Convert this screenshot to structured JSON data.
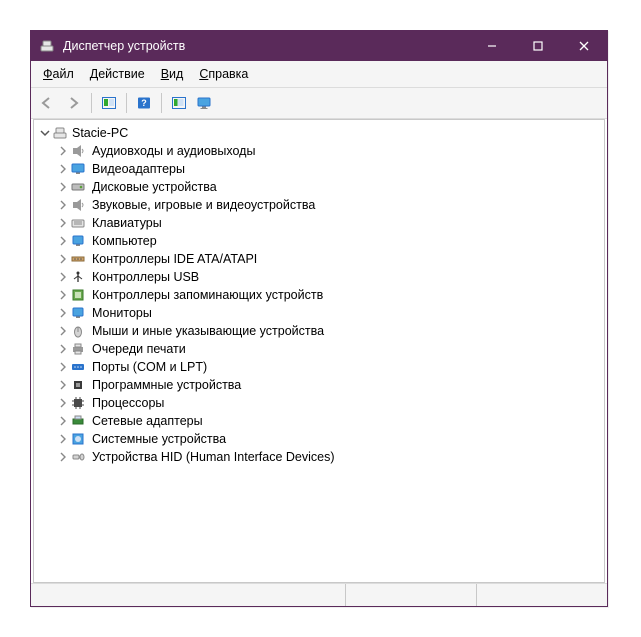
{
  "window": {
    "title": "Диспетчер устройств"
  },
  "menu": {
    "file": {
      "label": "Файл",
      "ul": "Ф"
    },
    "action": {
      "label": "Действие",
      "ul": "Д"
    },
    "view": {
      "label": "Вид",
      "ul": "В"
    },
    "help": {
      "label": "Справка",
      "ul": "С"
    }
  },
  "tree": {
    "root": "Stacie-PC",
    "items": [
      {
        "label": "Аудиовходы и аудиовыходы",
        "icon": "audio-icon"
      },
      {
        "label": "Видеоадаптеры",
        "icon": "display-adapter-icon"
      },
      {
        "label": "Дисковые устройства",
        "icon": "disk-icon"
      },
      {
        "label": "Звуковые, игровые и видеоустройства",
        "icon": "audio-icon"
      },
      {
        "label": "Клавиатуры",
        "icon": "keyboard-icon"
      },
      {
        "label": "Компьютер",
        "icon": "computer-icon"
      },
      {
        "label": "Контроллеры IDE ATA/ATAPI",
        "icon": "ide-icon"
      },
      {
        "label": "Контроллеры USB",
        "icon": "usb-icon"
      },
      {
        "label": "Контроллеры запоминающих устройств",
        "icon": "storage-icon"
      },
      {
        "label": "Мониторы",
        "icon": "monitor-icon"
      },
      {
        "label": "Мыши и иные указывающие устройства",
        "icon": "mouse-icon"
      },
      {
        "label": "Очереди печати",
        "icon": "printer-icon"
      },
      {
        "label": "Порты (COM и LPT)",
        "icon": "port-icon"
      },
      {
        "label": "Программные устройства",
        "icon": "software-device-icon"
      },
      {
        "label": "Процессоры",
        "icon": "cpu-icon"
      },
      {
        "label": "Сетевые адаптеры",
        "icon": "network-icon"
      },
      {
        "label": "Системные устройства",
        "icon": "system-icon"
      },
      {
        "label": "Устройства HID (Human Interface Devices)",
        "icon": "hid-icon"
      }
    ]
  }
}
